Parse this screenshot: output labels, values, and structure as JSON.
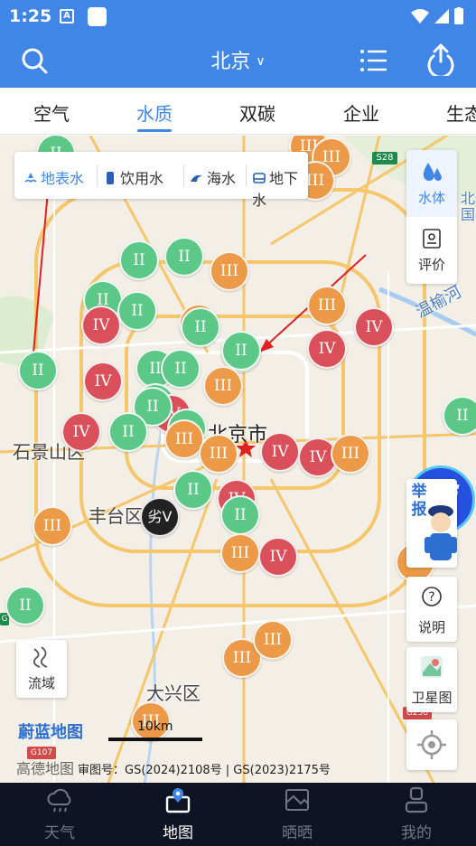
{
  "status": {
    "time": "1:25",
    "sim_label": "A"
  },
  "header": {
    "city": "北京"
  },
  "tabs": [
    {
      "label": "空气"
    },
    {
      "label": "水质"
    },
    {
      "label": "双碳"
    },
    {
      "label": "企业"
    },
    {
      "label": "生态"
    }
  ],
  "active_tab": "水质",
  "filters": [
    {
      "label": "地表水",
      "active": true
    },
    {
      "label": "饮用水"
    },
    {
      "label": "海水"
    },
    {
      "label": "地下水"
    }
  ],
  "side_panel": {
    "water_body": "水体",
    "evaluation": "评价",
    "report": "举报",
    "explain": "说明",
    "satellite": "卫星图",
    "basin": "流域",
    "ai": "Ai"
  },
  "map": {
    "places": [
      "北京市",
      "石景山区",
      "丰台区",
      "大兴区",
      "温榆河",
      "北",
      "国"
    ],
    "road_badges": [
      "S28",
      "G230",
      "G107",
      "G"
    ],
    "brand": "蔚蓝地图",
    "scale": "10km",
    "provider": "高德地图",
    "license": "审图号：GS(2024)2108号 | GS(2023)2175号"
  },
  "markers": [
    {
      "level": "II"
    },
    {
      "level": "III"
    },
    {
      "level": "III"
    },
    {
      "level": "III"
    },
    {
      "level": "II"
    },
    {
      "level": "II"
    },
    {
      "level": "III"
    },
    {
      "level": "II"
    },
    {
      "level": "II"
    },
    {
      "level": "IV"
    },
    {
      "level": "III"
    },
    {
      "level": "II"
    },
    {
      "level": "III"
    },
    {
      "level": "IV"
    },
    {
      "level": "II"
    },
    {
      "level": "IV"
    },
    {
      "level": "II"
    },
    {
      "level": "II"
    },
    {
      "level": "II"
    },
    {
      "level": "II"
    },
    {
      "level": "III"
    },
    {
      "level": "IV"
    },
    {
      "level": "II"
    },
    {
      "level": "IV"
    },
    {
      "level": "II"
    },
    {
      "level": "II"
    },
    {
      "level": "IV"
    },
    {
      "level": "II"
    },
    {
      "level": "III"
    },
    {
      "level": "III"
    },
    {
      "level": "IV"
    },
    {
      "level": "IV"
    },
    {
      "level": "III"
    },
    {
      "level": "II"
    },
    {
      "level": "IV"
    },
    {
      "level": "II"
    },
    {
      "level": "III"
    },
    {
      "level": "劣V"
    },
    {
      "level": "III"
    },
    {
      "level": "IV"
    },
    {
      "level": "II"
    },
    {
      "level": "III"
    },
    {
      "level": "III"
    },
    {
      "level": "III"
    },
    {
      "level": "II"
    },
    {
      "level": "III"
    }
  ],
  "bottom_nav": [
    {
      "label": "天气"
    },
    {
      "label": "地图",
      "active": true
    },
    {
      "label": "晒晒"
    },
    {
      "label": "我的"
    }
  ],
  "colors": {
    "primary": "#3f86e6",
    "level_ii": "#5cc887",
    "level_iii": "#ec9a47",
    "level_iv": "#d9505a",
    "level_bad": "#222222",
    "bottom_bg": "#0f1424"
  }
}
